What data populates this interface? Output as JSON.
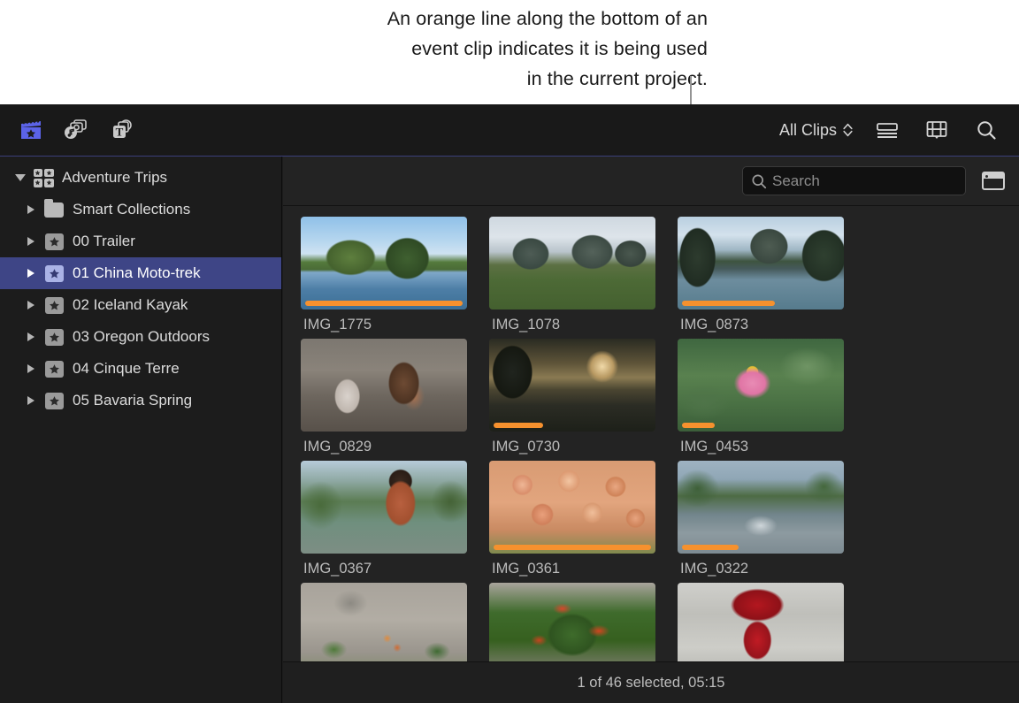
{
  "callout": {
    "lines": [
      "An orange line along the bottom of an",
      "event clip indicates it is being used",
      "in the current project."
    ]
  },
  "toolbar": {
    "left_buttons": [
      {
        "name": "libraries-button",
        "icon": "clapperboard-star-icon",
        "active": true
      },
      {
        "name": "photos-audio-button",
        "icon": "photos-audio-icon",
        "active": false
      },
      {
        "name": "titles-generators-button",
        "icon": "titles-generators-icon",
        "active": false
      }
    ],
    "clip_filter_label": "All Clips",
    "right_buttons": [
      {
        "name": "list-view-button",
        "icon": "list-view-icon"
      },
      {
        "name": "filmstrip-view-button",
        "icon": "filmstrip-icon"
      },
      {
        "name": "search-button",
        "icon": "search-icon"
      }
    ]
  },
  "sidebar": {
    "items": [
      {
        "label": "Adventure Trips",
        "icon": "library-grid-icon",
        "level": 0,
        "disclosure": "open",
        "selected": false
      },
      {
        "label": "Smart Collections",
        "icon": "folder-icon",
        "level": 1,
        "disclosure": "closed",
        "selected": false
      },
      {
        "label": "00 Trailer",
        "icon": "star-badge-icon",
        "level": 1,
        "disclosure": "closed",
        "selected": false
      },
      {
        "label": "01 China Moto-trek",
        "icon": "star-badge-icon",
        "level": 1,
        "disclosure": "closed",
        "selected": true
      },
      {
        "label": "02 Iceland Kayak",
        "icon": "star-badge-icon",
        "level": 1,
        "disclosure": "closed",
        "selected": false
      },
      {
        "label": "03 Oregon Outdoors",
        "icon": "star-badge-icon",
        "level": 1,
        "disclosure": "closed",
        "selected": false
      },
      {
        "label": "04 Cinque Terre",
        "icon": "star-badge-icon",
        "level": 1,
        "disclosure": "closed",
        "selected": false
      },
      {
        "label": "05 Bavaria Spring",
        "icon": "star-badge-icon",
        "level": 1,
        "disclosure": "closed",
        "selected": false
      }
    ]
  },
  "browser": {
    "search": {
      "placeholder": "Search",
      "value": ""
    },
    "panel_toggle_icon": "window-panel-icon",
    "clips": [
      {
        "name": "IMG_1775",
        "art": "art-1775",
        "used": true,
        "used_pct": 96
      },
      {
        "name": "IMG_1078",
        "art": "art-1078",
        "used": false,
        "used_pct": 0
      },
      {
        "name": "IMG_0873",
        "art": "art-0873",
        "used": true,
        "used_pct": 57
      },
      {
        "name": "IMG_0829",
        "art": "art-0829",
        "used": false,
        "used_pct": 0
      },
      {
        "name": "IMG_0730",
        "art": "art-0730",
        "used": true,
        "used_pct": 30
      },
      {
        "name": "IMG_0453",
        "art": "art-0453",
        "used": true,
        "used_pct": 20
      },
      {
        "name": "IMG_0367",
        "art": "art-0367",
        "used": false,
        "used_pct": 0
      },
      {
        "name": "IMG_0361",
        "art": "art-0361",
        "used": true,
        "used_pct": 96
      },
      {
        "name": "IMG_0322",
        "art": "art-0322",
        "used": true,
        "used_pct": 35
      },
      {
        "name": "",
        "art": "art-veg",
        "used": false,
        "used_pct": 0
      },
      {
        "name": "",
        "art": "art-chili",
        "used": false,
        "used_pct": 0
      },
      {
        "name": "",
        "art": "art-lantern",
        "used": false,
        "used_pct": 0
      }
    ]
  },
  "status": {
    "text": "1 of 46 selected, 05:15"
  },
  "colors": {
    "accent_orange": "#f6912e",
    "selection_indigo": "#3e4586",
    "library_blue": "#5b63e8",
    "window_background": "#232323",
    "sidebar_background": "#1c1c1c"
  }
}
